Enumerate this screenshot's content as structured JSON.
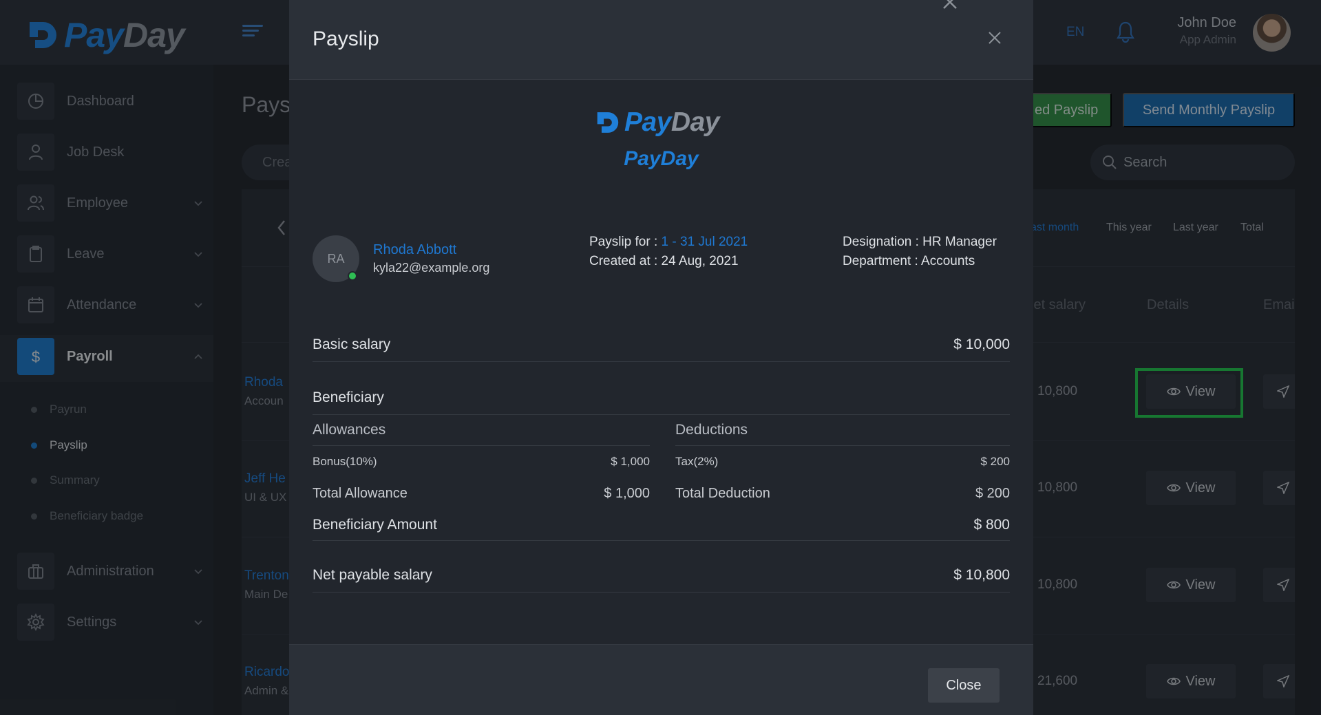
{
  "app": {
    "brand_pay": "Pay",
    "brand_day": "Day",
    "language": "EN",
    "user": {
      "name": "John Doe",
      "role": "App Admin"
    }
  },
  "sidebar": {
    "items": [
      {
        "label": "Dashboard",
        "icon": "pie-chart-icon"
      },
      {
        "label": "Job Desk",
        "icon": "user-icon"
      },
      {
        "label": "Employee",
        "icon": "users-icon"
      },
      {
        "label": "Leave",
        "icon": "clipboard-icon"
      },
      {
        "label": "Attendance",
        "icon": "calendar-icon"
      },
      {
        "label": "Payroll",
        "icon": "dollar-icon"
      },
      {
        "label": "Administration",
        "icon": "briefcase-icon"
      },
      {
        "label": "Settings",
        "icon": "gear-icon"
      }
    ],
    "payroll_sub": [
      "Payrun",
      "Payslip",
      "Summary",
      "Beneficiary badge"
    ]
  },
  "page": {
    "title": "Pays",
    "green_button": "ed Payslip",
    "blue_button": "Send Monthly Payslip",
    "left_pill": "Crea",
    "search_placeholder": "Search",
    "period_tabs": [
      "ast month",
      "This year",
      "Last year",
      "Total"
    ],
    "columns": {
      "net_salary": "let salary",
      "details": "Details",
      "email": "Emai"
    },
    "rows": [
      {
        "name": "Rhoda",
        "sub": "Accoun",
        "net": "10,800",
        "view": "View"
      },
      {
        "name": "Jeff He",
        "sub": "UI & UX",
        "net": "10,800",
        "view": "View"
      },
      {
        "name": "Trenton",
        "sub": "Main De",
        "net": "10,800",
        "view": "View"
      },
      {
        "name": "Ricardo",
        "sub": "Admin &",
        "net": "21,600",
        "view": "View"
      }
    ]
  },
  "modal": {
    "title": "Payslip",
    "logo_pay": "Pay",
    "logo_day": "Day",
    "company": "PayDay",
    "employee": {
      "initials": "RA",
      "name": "Rhoda Abbott",
      "email": "kyla22@example.org"
    },
    "payslip_for_label": "Payslip for :",
    "payslip_for_value": "1 - 31 Jul 2021",
    "created_at": "Created at : 24 Aug, 2021",
    "designation": "Designation : HR Manager",
    "department": "Department : Accounts",
    "basic_salary_label": "Basic salary",
    "basic_salary_value": "$ 10,000",
    "beneficiary_label": "Beneficiary",
    "allowances_label": "Allowances",
    "deductions_label": "Deductions",
    "allowance_item_label": "Bonus(10%)",
    "allowance_item_value": "$ 1,000",
    "deduction_item_label": "Tax(2%)",
    "deduction_item_value": "$ 200",
    "total_allowance_label": "Total Allowance",
    "total_allowance_value": "$ 1,000",
    "total_deduction_label": "Total Deduction",
    "total_deduction_value": "$ 200",
    "beneficiary_amount_label": "Beneficiary Amount",
    "beneficiary_amount_value": "$ 800",
    "net_payable_label": "Net payable salary",
    "net_payable_value": "$ 10,800",
    "close_button": "Close"
  },
  "colors": {
    "accent_blue": "#1f78d1",
    "success_green": "#2fbe54",
    "highlight": "#22c54a"
  }
}
